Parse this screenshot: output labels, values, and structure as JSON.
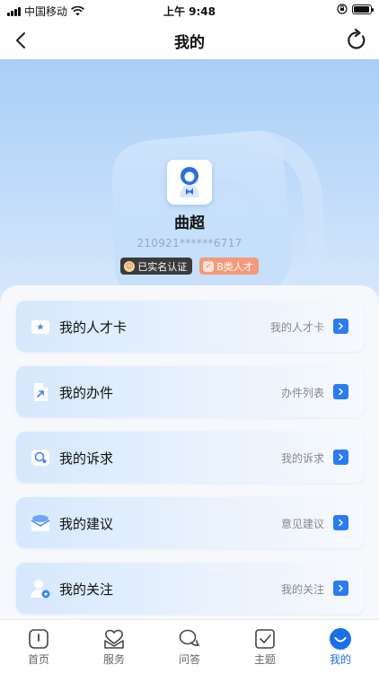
{
  "status_bar": {
    "carrier": "中国移动",
    "time": "上午 9:48",
    "signal_icon": "cell-signal-icon",
    "wifi_icon": "wifi-icon",
    "lock_icon": "orientation-lock-icon",
    "battery_icon": "battery-icon"
  },
  "nav": {
    "title": "我的",
    "back_icon": "back-arrow-icon",
    "refresh_icon": "refresh-icon"
  },
  "profile": {
    "name": "曲超",
    "id_masked": "210921******6717",
    "badges": [
      {
        "label": "已实名认证",
        "icon": "verified-icon"
      },
      {
        "label": "B类人才",
        "icon": "talent-icon"
      }
    ]
  },
  "menu": [
    {
      "label": "我的人才卡",
      "right_text": "我的人才卡",
      "icon": "talent-card-icon"
    },
    {
      "label": "我的办件",
      "right_text": "办件列表",
      "icon": "document-icon"
    },
    {
      "label": "我的诉求",
      "right_text": "我的诉求",
      "icon": "chat-bubble-icon"
    },
    {
      "label": "我的建议",
      "right_text": "意见建议",
      "icon": "mail-suggestion-icon"
    },
    {
      "label": "我的关注",
      "right_text": "我的关注",
      "icon": "user-favorite-icon"
    }
  ],
  "tabbar": [
    {
      "label": "首页",
      "icon": "home-icon",
      "active": false
    },
    {
      "label": "服务",
      "icon": "service-icon",
      "active": false
    },
    {
      "label": "问答",
      "icon": "qa-icon",
      "active": false
    },
    {
      "label": "主题",
      "icon": "topic-icon",
      "active": false
    },
    {
      "label": "我的",
      "icon": "profile-icon",
      "active": true
    }
  ],
  "colors": {
    "accent": "#2a7cf3",
    "hero_top": "#a9cff7",
    "verified_badge": "#3b3b3b",
    "talent_badge": "#f39a7c",
    "tab_active": "#1b6fe8"
  }
}
